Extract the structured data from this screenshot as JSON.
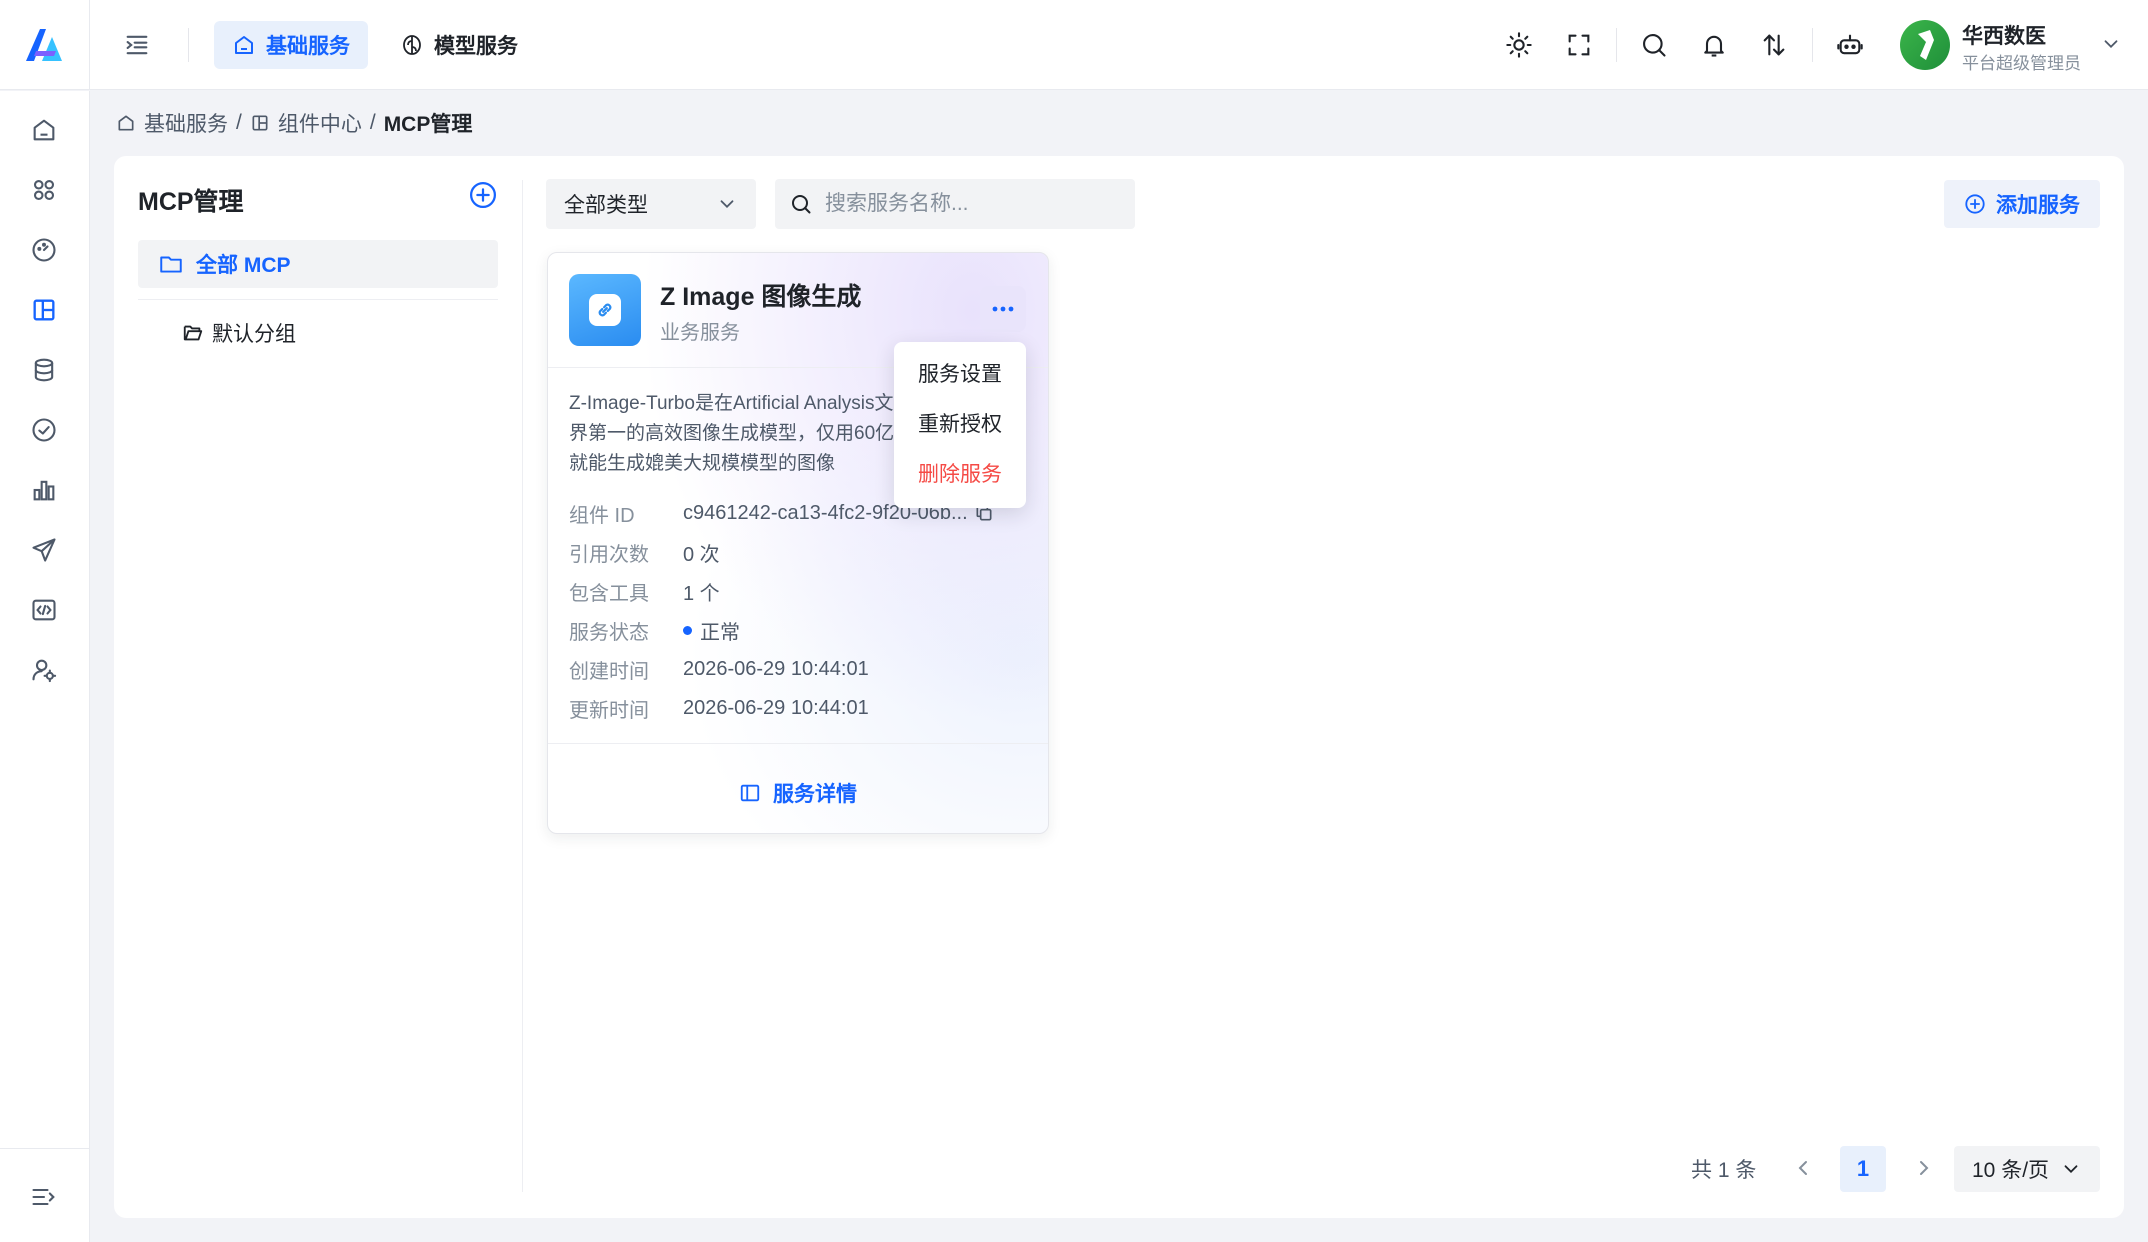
{
  "header": {
    "tabs": [
      {
        "label": "基础服务",
        "active": true
      },
      {
        "label": "模型服务",
        "active": false
      }
    ],
    "icons": [
      "sun-icon",
      "fullscreen-icon",
      "search-icon",
      "bell-icon",
      "sort-arrows-icon",
      "robot-icon"
    ],
    "user": {
      "name": "华西数医",
      "role": "平台超级管理员"
    }
  },
  "nav": {
    "icons": [
      "home-icon",
      "apps-icon",
      "dashboard-icon",
      "layout-icon",
      "database-icon",
      "check-circle-icon",
      "bar-chart-icon",
      "send-icon",
      "code-icon",
      "user-settings-icon"
    ],
    "active": "layout-icon",
    "bottom_icon": "expand-menu-icon"
  },
  "breadcrumb": {
    "items": [
      "基础服务",
      "组件中心"
    ],
    "current": "MCP管理",
    "sep": "/"
  },
  "sidebar": {
    "title": "MCP管理",
    "groups": [
      {
        "label": "全部 MCP",
        "active": true
      },
      {
        "label": "默认分组",
        "active": false
      }
    ]
  },
  "toolbar": {
    "type_select": "全部类型",
    "search_placeholder": "搜索服务名称...",
    "add_label": "添加服务"
  },
  "card": {
    "title": "Z Image 图像生成",
    "subtitle": "业务服务",
    "description": "Z-Image-Turbo是在Artificial Analysis文生图开源模型世界第一的高效图像生成模型，仅用60亿参数和8步推理就能生成媲美大规模模型的图像",
    "meta": [
      {
        "label": "组件 ID",
        "value": "c9461242-ca13-4fc2-9f20-06b..."
      },
      {
        "label": "引用次数",
        "value": "0 次"
      },
      {
        "label": "包含工具",
        "value": "1 个"
      },
      {
        "label": "服务状态",
        "value": "正常"
      },
      {
        "label": "创建时间",
        "value": "2026-06-29 10:44:01"
      },
      {
        "label": "更新时间",
        "value": "2026-06-29 10:44:01"
      }
    ],
    "detail_label": "服务详情",
    "status_color": "#1664ff"
  },
  "dropdown": {
    "items": [
      {
        "label": "服务设置",
        "danger": false
      },
      {
        "label": "重新授权",
        "danger": false
      },
      {
        "label": "删除服务",
        "danger": true
      }
    ]
  },
  "pagination": {
    "total": "共 1 条",
    "current_page": "1",
    "page_size": "10 条/页"
  },
  "colors": {
    "accent": "#1664ff",
    "danger": "#f54a45",
    "brand_green": "#2ea043"
  }
}
